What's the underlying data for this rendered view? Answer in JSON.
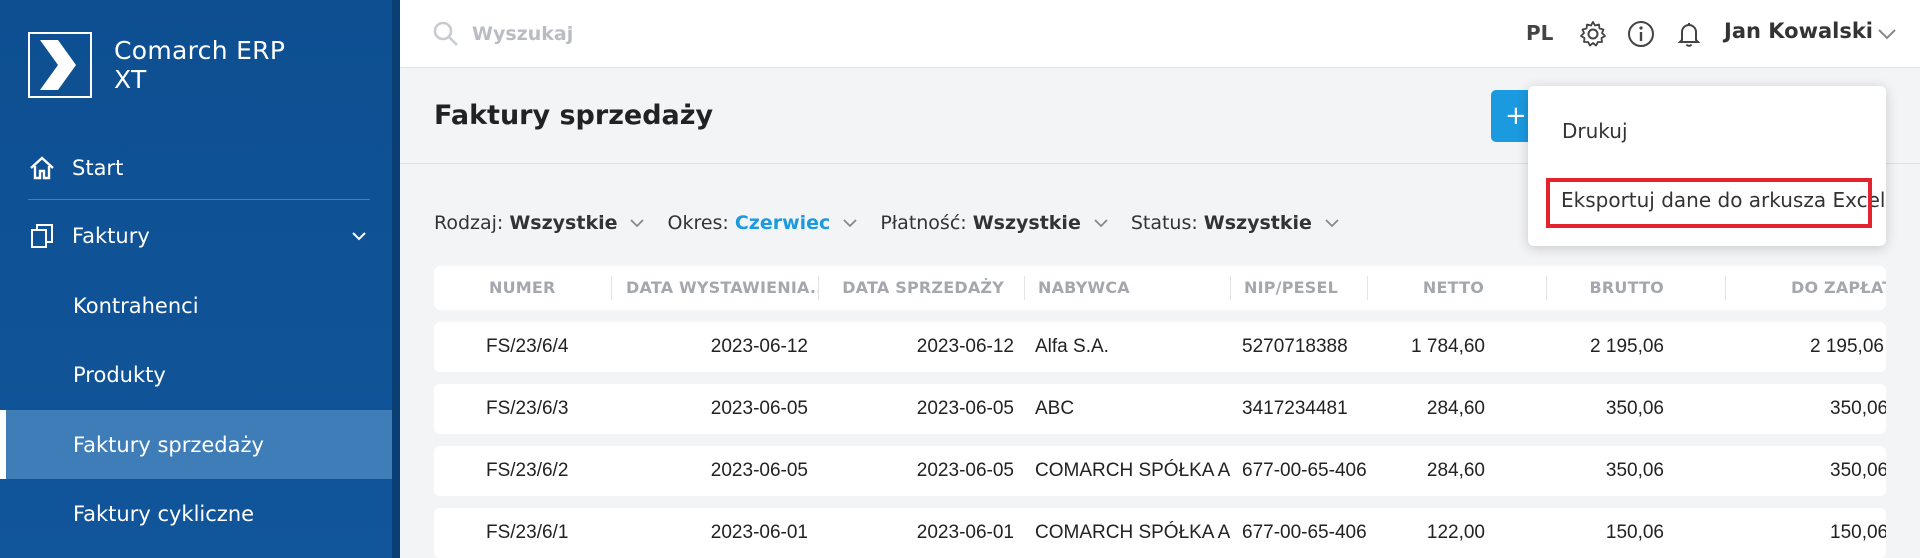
{
  "app": {
    "name": "Comarch ERP XT"
  },
  "sidebar": {
    "items": [
      {
        "label": "Start",
        "icon": "home-icon"
      },
      {
        "label": "Faktury",
        "icon": "documents-icon"
      },
      {
        "label": "Kontrahenci"
      },
      {
        "label": "Produkty"
      },
      {
        "label": "Faktury sprzedaży",
        "active": true
      },
      {
        "label": "Faktury cykliczne"
      }
    ]
  },
  "topbar": {
    "search_placeholder": "Wyszukaj",
    "language": "PL",
    "user_name": "Jan Kowalski"
  },
  "page": {
    "title": "Faktury sprzedaży",
    "add_label": "+"
  },
  "filters": [
    {
      "key": "Rodzaj:",
      "value": "Wszystkie"
    },
    {
      "key": "Okres:",
      "value": "Czerwiec"
    },
    {
      "key": "Płatność:",
      "value": "Wszystkie"
    },
    {
      "key": "Status:",
      "value": "Wszystkie"
    }
  ],
  "table": {
    "columns": [
      "NUMER",
      "DATA WYSTAWIENIA...",
      "DATA SPRZEDAŻY",
      "NABYWCA",
      "NIP/PESEL",
      "NETTO",
      "BRUTTO",
      "DO ZAPŁATY"
    ],
    "rows": [
      [
        "FS/23/6/4",
        "2023-06-12",
        "2023-06-12",
        "Alfa S.A.",
        "5270718388",
        "1 784,60",
        "2 195,06",
        "2 195,06"
      ],
      [
        "FS/23/6/3",
        "2023-06-05",
        "2023-06-05",
        "ABC",
        "3417234481",
        "284,60",
        "350,06",
        "350,06"
      ],
      [
        "FS/23/6/2",
        "2023-06-05",
        "2023-06-05",
        "COMARCH SPÓŁKA AKCYJNA",
        "677-00-65-406",
        "284,60",
        "350,06",
        "350,06"
      ],
      [
        "FS/23/6/1",
        "2023-06-01",
        "2023-06-01",
        "COMARCH SPÓŁKA AKCYJNA",
        "677-00-65-406",
        "122,00",
        "150,06",
        "150,06"
      ]
    ]
  },
  "menu": {
    "items": [
      "Drukuj",
      "Eksportuj dane do arkusza Excel"
    ]
  },
  "colors": {
    "sidebar": "#0d4f91",
    "accent": "#1b9ae0",
    "highlight": "#e4242c"
  }
}
